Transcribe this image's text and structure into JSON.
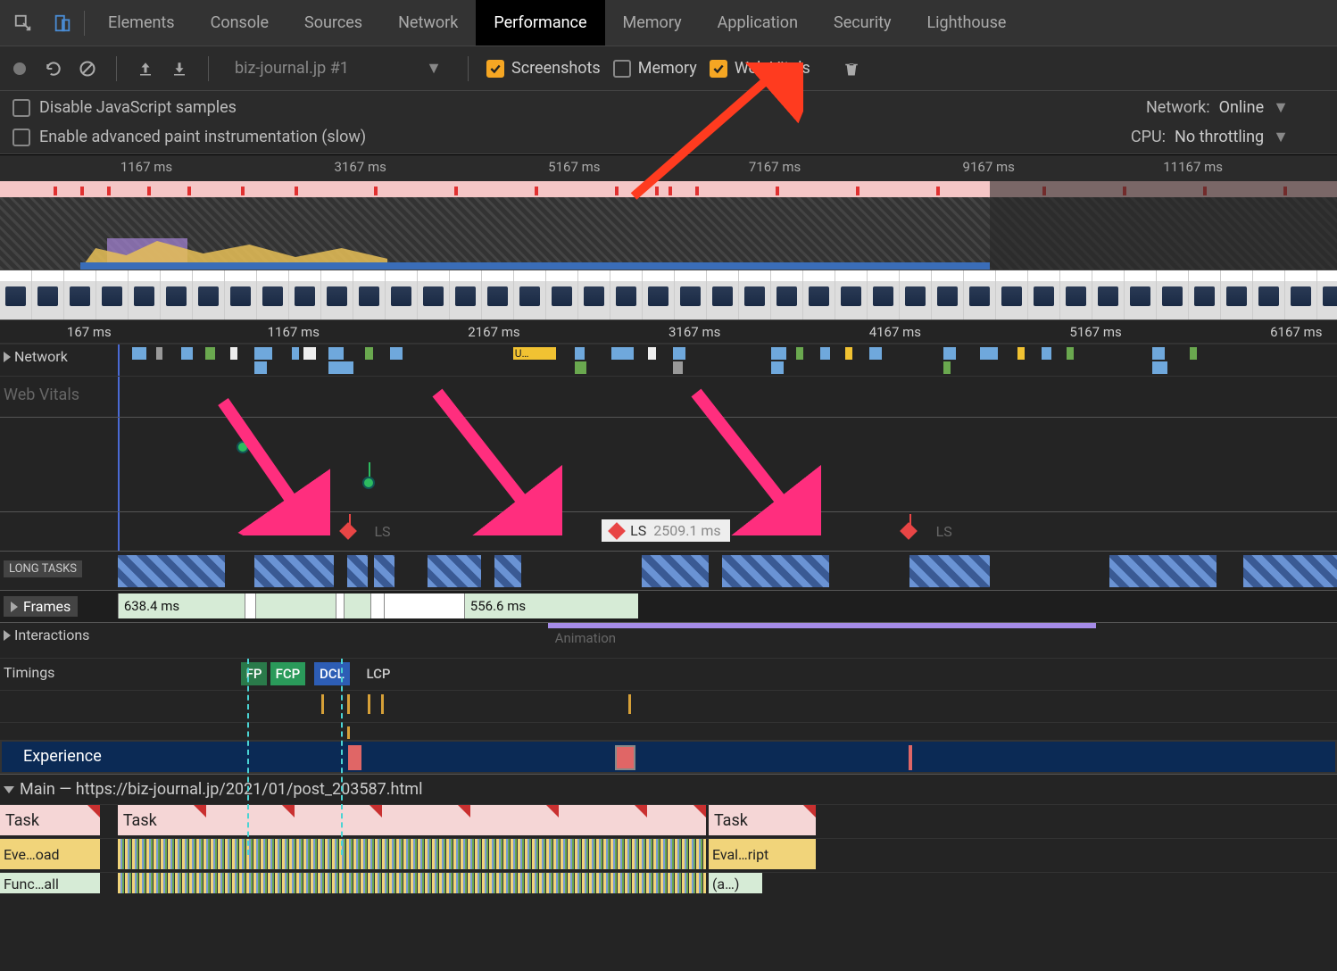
{
  "tabs": {
    "items": [
      "Elements",
      "Console",
      "Sources",
      "Network",
      "Performance",
      "Memory",
      "Application",
      "Security",
      "Lighthouse"
    ],
    "active": "Performance"
  },
  "toolbar": {
    "dropdown": "biz-journal.jp #1",
    "check_screenshots": "Screenshots",
    "check_memory": "Memory",
    "check_web_vitals": "Web Vitals"
  },
  "options": {
    "disable_js": "Disable JavaScript samples",
    "enable_paint": "Enable advanced paint instrumentation (slow)",
    "network_label": "Network:",
    "network_value": "Online",
    "cpu_label": "CPU:",
    "cpu_value": "No throttling"
  },
  "overview_ticks": [
    "1167 ms",
    "3167 ms",
    "5167 ms",
    "7167 ms",
    "9167 ms",
    "11167 ms"
  ],
  "detail_ticks": [
    "167 ms",
    "1167 ms",
    "2167 ms",
    "3167 ms",
    "4167 ms",
    "5167 ms",
    "6167 ms"
  ],
  "tracks": {
    "network": "Network",
    "web_vitals": "Web Vitals",
    "long_tasks": "LONG TASKS",
    "frames": "Frames",
    "interactions": "Interactions",
    "timings": "Timings",
    "experience": "Experience",
    "main": "Main — https://biz-journal.jp/2021/01/post_203587.html",
    "animation": "Animation"
  },
  "ls_tooltip": {
    "label": "LS",
    "value": "2509.1 ms"
  },
  "ls_markers_dim": [
    "LS",
    "LS"
  ],
  "frame_values": [
    "638.4 ms",
    "556.6 ms"
  ],
  "timing_badges": [
    "FP",
    "FCP",
    "DCL",
    "LCP"
  ],
  "flame": {
    "task": "Task",
    "eval_left": "Eve…oad",
    "eval_right": "Eval…ript",
    "func": "Func…all",
    "paren": "(a…)"
  },
  "network_label_short": "U…"
}
